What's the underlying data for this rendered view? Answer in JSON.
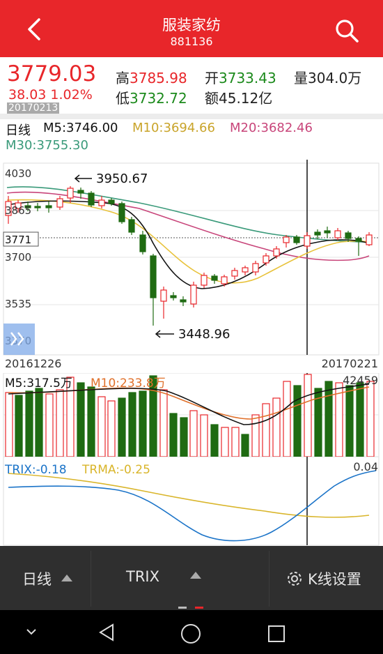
{
  "header": {
    "title": "服装家纺",
    "code": "881136",
    "back_icon": "chevron-left-icon",
    "search_icon": "search-icon"
  },
  "quote": {
    "price": "3779.03",
    "change": "38.03 1.02%",
    "date": "20170213",
    "high_label": "高",
    "high": "3785.98",
    "open_label": "开",
    "open": "3733.43",
    "volume_label": "量",
    "volume": "304.0万",
    "low_label": "低",
    "low": "3732.72",
    "amount_label": "额",
    "amount": "45.12亿"
  },
  "ma_legend": {
    "period": "日线",
    "m5": "M5:3746.00",
    "m10": "M10:3694.66",
    "m20": "M20:3682.46",
    "m30": "M30:3755.30"
  },
  "kline": {
    "y_ticks": [
      "4030",
      "3865",
      "3771",
      "3700",
      "3535",
      "3370"
    ],
    "high_annotation": "3950.67",
    "low_annotation": "3448.96",
    "start_date": "20161226",
    "end_date": "20170221",
    "expand_icon": "double-chevron-right-icon"
  },
  "volume": {
    "m5": "M5:317.5万",
    "m10": "M10:233.8万",
    "max_label": "42459"
  },
  "trix": {
    "trix": "TRIX:-0.18",
    "trma": "TRMA:-0.25",
    "max_label": "0.04"
  },
  "toolbar": {
    "period_label": "日线",
    "indicator_label": "TRIX",
    "settings_label": "K线设置",
    "settings_icon": "gear-icon"
  },
  "colors": {
    "header_red": "#e8262a",
    "up": "#e8262a",
    "down": "#1f6b12",
    "m5": "#111111",
    "m10": "#e8c23a",
    "m20": "#c8457a",
    "m30": "#3a9a7a",
    "trix": "#1a73c8",
    "trma": "#d9b52a",
    "volume_m10": "#e0702a"
  },
  "chart_data": [
    {
      "type": "candlestick",
      "y_ticks": [
        4030,
        3865,
        3771,
        3700,
        3535,
        3370
      ],
      "ylim": [
        3370,
        4030
      ],
      "x_range": [
        "20161226",
        "20170221"
      ],
      "high": 3950.67,
      "low": 3448.96,
      "series": [
        {
          "name": "M5",
          "last": 3746.0
        },
        {
          "name": "M10",
          "last": 3694.66
        },
        {
          "name": "M20",
          "last": 3682.46
        },
        {
          "name": "M30",
          "last": 3755.3
        }
      ]
    },
    {
      "type": "bar",
      "series": [
        {
          "name": "M5",
          "last": "317.5万"
        },
        {
          "name": "M10",
          "last": "233.8万"
        }
      ],
      "max": 42459
    },
    {
      "type": "line",
      "series": [
        {
          "name": "TRIX",
          "last": -0.18
        },
        {
          "name": "TRMA",
          "last": -0.25
        }
      ],
      "max": 0.04
    }
  ]
}
